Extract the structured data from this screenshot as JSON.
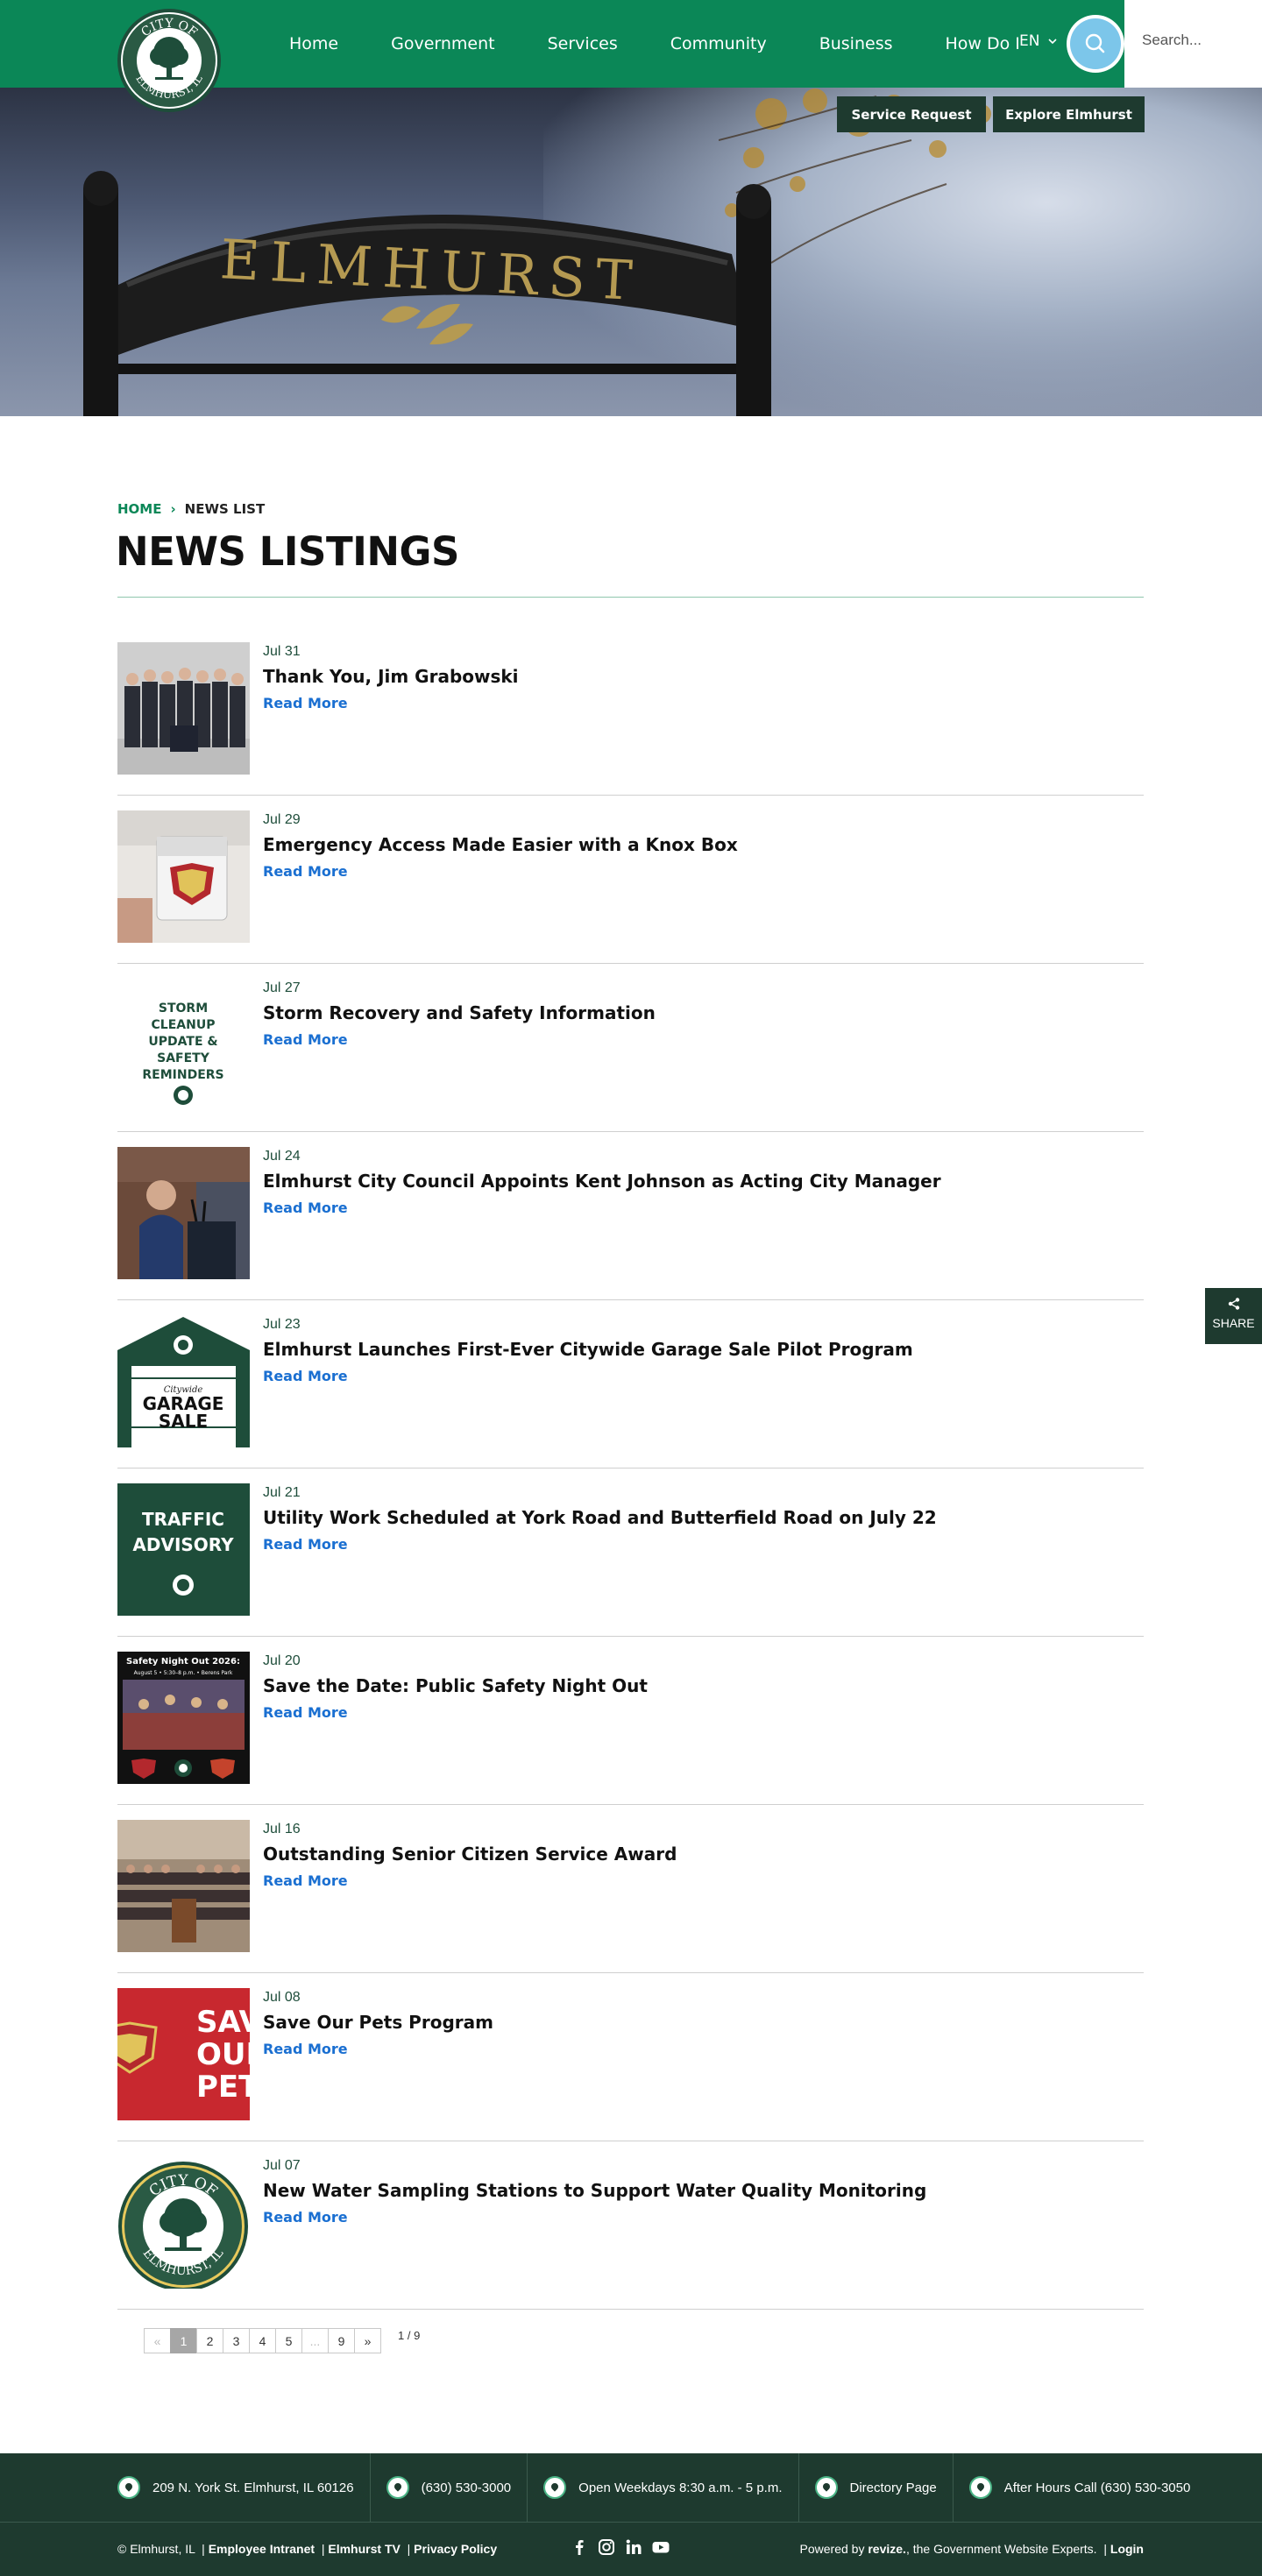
{
  "header": {
    "logo_text_top": "CITY OF",
    "logo_text_bottom": "ELMHURST, IL",
    "nav": [
      "Home",
      "Government",
      "Services",
      "Community",
      "Business",
      "How Do I"
    ],
    "lang": "EN",
    "search_placeholder": "Search..."
  },
  "hero": {
    "sign_text": "ELMHURST",
    "buttons": [
      "Service Request",
      "Explore Elmhurst"
    ]
  },
  "breadcrumb": {
    "home": "HOME",
    "separator": "›",
    "current": "NEWS LIST"
  },
  "page_title": "NEWS LISTINGS",
  "news": [
    {
      "date": "Jul 31",
      "title": "Thank You, Jim Grabowski",
      "read_more": "Read More",
      "thumb": "group-photo"
    },
    {
      "date": "Jul 29",
      "title": "Emergency Access Made Easier with a Knox Box",
      "read_more": "Read More",
      "thumb": "knox-box"
    },
    {
      "date": "Jul 27",
      "title": "Storm Recovery and Safety Information",
      "read_more": "Read More",
      "thumb": "storm-graphic",
      "thumb_text": [
        "STORM",
        "CLEANUP",
        "UPDATE &",
        "SAFETY",
        "REMINDERS"
      ]
    },
    {
      "date": "Jul 24",
      "title": "Elmhurst City Council Appoints Kent Johnson as Acting City Manager",
      "read_more": "Read More",
      "thumb": "podium-speaker"
    },
    {
      "date": "Jul 23",
      "title": "Elmhurst Launches First-Ever Citywide Garage Sale Pilot Program",
      "read_more": "Read More",
      "thumb": "garage-sale",
      "thumb_text": [
        "Citywide",
        "GARAGE",
        "SALE"
      ]
    },
    {
      "date": "Jul 21",
      "title": "Utility Work Scheduled at York Road and Butterfield Road on July 22",
      "read_more": "Read More",
      "thumb": "traffic-advisory",
      "thumb_text": [
        "TRAFFIC",
        "ADVISORY"
      ]
    },
    {
      "date": "Jul 20",
      "title": "Save the Date: Public Safety Night Out",
      "read_more": "Read More",
      "thumb": "safety-night",
      "thumb_text": [
        "Safety Night Out 2026:",
        "August 5 • 5:30–8 p.m. • Berens Park"
      ]
    },
    {
      "date": "Jul 16",
      "title": "Outstanding Senior Citizen Service Award",
      "read_more": "Read More",
      "thumb": "council-chamber"
    },
    {
      "date": "Jul 08",
      "title": "Save Our Pets Program",
      "read_more": "Read More",
      "thumb": "save-pets",
      "thumb_text": [
        "SAV",
        "OUR",
        "PETS"
      ]
    },
    {
      "date": "Jul 07",
      "title": "New Water Sampling Stations to Support Water Quality Monitoring",
      "read_more": "Read More",
      "thumb": "city-seal",
      "thumb_text": [
        "CITY OF",
        "ELMHURST, IL"
      ]
    }
  ],
  "pagination": {
    "prev": "«",
    "pages": [
      "1",
      "2",
      "3",
      "4",
      "5",
      "...",
      "9"
    ],
    "next": "»",
    "active": "1",
    "count": "1 / 9"
  },
  "share": {
    "label": "SHARE"
  },
  "footer": {
    "info": [
      {
        "icon": "seal-icon",
        "text": "209 N. York St. Elmhurst, IL 60126"
      },
      {
        "icon": "location-pin-icon",
        "text": "(630) 530-3000"
      },
      {
        "icon": "location-pin-icon",
        "text": "Open Weekdays 8:30 a.m. - 5 p.m."
      },
      {
        "icon": "location-pin-icon",
        "text": "Directory Page"
      },
      {
        "icon": "location-pin-icon",
        "text": "After Hours Call (630) 530-3050"
      }
    ],
    "copyright": "© Elmhurst, IL",
    "links": [
      "Employee Intranet",
      "Elmhurst TV",
      "Privacy Policy"
    ],
    "social": [
      "facebook-icon",
      "instagram-icon",
      "linkedin-icon",
      "youtube-icon"
    ],
    "powered_prefix": "Powered by",
    "powered_brand": "revize.",
    "powered_suffix": "the Government Website Experts.",
    "login": "Login"
  },
  "colors": {
    "header_green": "#0b8757",
    "dark_green": "#1e3a2f",
    "link_blue": "#1a6fd1",
    "search_circle": "#7cc6ea"
  }
}
